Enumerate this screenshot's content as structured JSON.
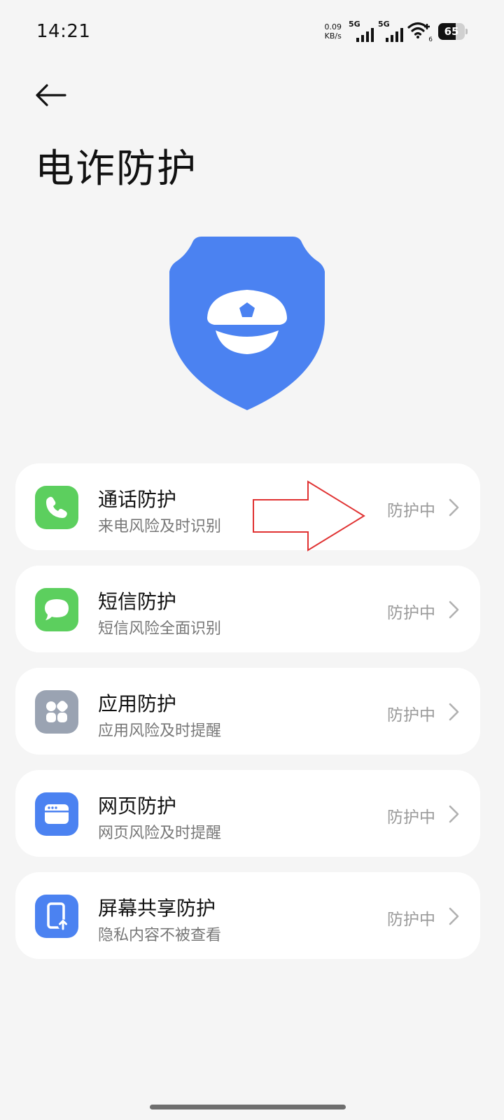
{
  "status_bar": {
    "time": "14:21",
    "net_speed_value": "0.09",
    "net_speed_unit": "KB/s",
    "sim1_tag": "5G",
    "sim2_tag": "5G",
    "wifi_sub": "6",
    "battery_level": 65,
    "battery_label": "65"
  },
  "page": {
    "title": "电诈防护"
  },
  "accent_color": "#4b82f1",
  "annotation_arrow_color": "#e03232",
  "items": [
    {
      "title": "通话防护",
      "subtitle": "来电风险及时识别",
      "status": "防护中",
      "icon": "phone-icon",
      "icon_color": "#5ccf5e"
    },
    {
      "title": "短信防护",
      "subtitle": "短信风险全面识别",
      "status": "防护中",
      "icon": "message-icon",
      "icon_color": "#5ccf5e"
    },
    {
      "title": "应用防护",
      "subtitle": "应用风险及时提醒",
      "status": "防护中",
      "icon": "apps-icon",
      "icon_color": "#9aa3b2"
    },
    {
      "title": "网页防护",
      "subtitle": "网页风险及时提醒",
      "status": "防护中",
      "icon": "browser-icon",
      "icon_color": "#4b82f1"
    },
    {
      "title": "屏幕共享防护",
      "subtitle": "隐私内容不被查看",
      "status": "防护中",
      "icon": "screen-share-icon",
      "icon_color": "#4b82f1"
    }
  ]
}
